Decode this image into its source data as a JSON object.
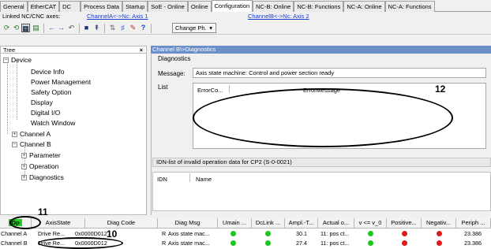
{
  "tabs": [
    "General",
    "EtherCAT",
    "DC",
    "Process Data",
    "Startup",
    "SoE - Online",
    "Online",
    "Configuration",
    "NC-B: Online",
    "NC-B: Functions",
    "NC-A: Online",
    "NC-A: Functions"
  ],
  "active_tab": "Configuration",
  "linked": {
    "label": "Linked NC/CNC axes:",
    "link_a": "ChannelA<->Nc: Axis 1",
    "link_b": "ChannelB<->Nc: Axis 2"
  },
  "toolbar": {
    "change_label": "Change Ph.",
    "question": "?"
  },
  "tree": {
    "title": "Tree",
    "close": "×",
    "nodes": [
      {
        "label": "Device",
        "exp": "−"
      },
      {
        "label": "Device Info"
      },
      {
        "label": "Power Management"
      },
      {
        "label": "Safety Option"
      },
      {
        "label": "Display"
      },
      {
        "label": "Digital I/O"
      },
      {
        "label": "Watch Window"
      },
      {
        "label": "Channel A",
        "exp": "+"
      },
      {
        "label": "Channel B",
        "exp": "−"
      },
      {
        "label": "Parameter",
        "exp": "+"
      },
      {
        "label": "Operation",
        "exp": "+"
      },
      {
        "label": "Diagnostics",
        "exp": "+"
      }
    ]
  },
  "panel": {
    "header": "Channel B\\>Diagnostics",
    "section": "Diagnostics",
    "message_label": "Message:",
    "message_value": "Axis state machine: Control and power section ready",
    "list_label": "List",
    "list_col1": "ErrorCo...",
    "list_col2": "ErrorMessage",
    "idn_header": "IDN-list of invalid operation data for CP2 (S-0-0021)",
    "idn_col1": "IDN",
    "idn_col2": "Name"
  },
  "grid": {
    "headers": [
      "Op",
      "AxisState",
      "Diag Code",
      "Diag Msg",
      "Umain ...",
      "DcLink ...",
      "Ampl.-T...",
      "Actual o...",
      "v <= v_0",
      "Positive...",
      "Negativ...",
      "Periph ..."
    ],
    "rows": [
      {
        "channel": "Channel A",
        "axis": "Drive Re...",
        "code": "0x0000D012",
        "r": "R",
        "msg": "Axis state mac...",
        "ampl": "30.1",
        "actual": "11: pos ct...",
        "periph": "23.386"
      },
      {
        "channel": "Channel B",
        "axis": "Drive Re...",
        "code": "0x0000D012",
        "r": "R",
        "msg": "Axis state mac...",
        "ampl": "27.4",
        "actual": "11: pos ct...",
        "periph": "23.386"
      }
    ]
  },
  "callouts": {
    "c10": "10",
    "c11": "11",
    "c12": "12"
  },
  "colors": {
    "status_ok": "#1fc61f",
    "status_error": "#e01a1a",
    "panel_header": "#6b8fc8",
    "link": "#1a3cc8"
  }
}
